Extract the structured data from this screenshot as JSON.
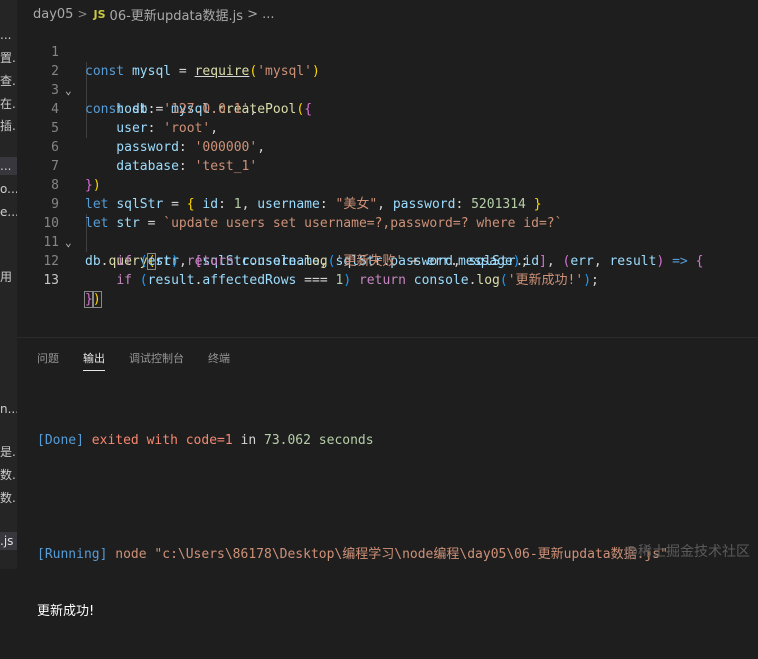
{
  "sidebar": {
    "items": [
      {
        "label": "...",
        "top": 0
      },
      {
        "label": "置...",
        "top": 0
      },
      {
        "label": "查...",
        "top": 0
      },
      {
        "label": "在...",
        "top": 0
      },
      {
        "label": "插...",
        "top": 0
      },
      {
        "label": "...",
        "top": 0
      },
      {
        "label": "o...",
        "top": 0
      },
      {
        "label": "e...",
        "top": 0
      },
      {
        "label": "用",
        "top": 0
      },
      {
        "label": "n...",
        "top": 0
      },
      {
        "label": "是...",
        "top": 0
      },
      {
        "label": "数...",
        "top": 0
      },
      {
        "label": "数...",
        "top": 0
      },
      {
        "label": ".js",
        "top": 0
      }
    ]
  },
  "breadcrumb": {
    "folder": "day05",
    "sep": ">",
    "icon": "JS",
    "file": "06-更新updata数据.js",
    "tail": "> ..."
  },
  "editor": {
    "line_numbers": [
      "1",
      "2",
      "3",
      "4",
      "5",
      "6",
      "7",
      "8",
      "9",
      "10",
      "11",
      "12",
      "13"
    ],
    "code": {
      "l1": [
        "const",
        " ",
        "mysql",
        " = ",
        "require",
        "(",
        "'mysql'",
        ")"
      ],
      "l2": [
        "const",
        " ",
        "db",
        " = ",
        "mysql",
        ".",
        "createPool",
        "(",
        "{"
      ],
      "l3": [
        "    host",
        ": ",
        "'127.0.0.1'",
        ","
      ],
      "l4": [
        "    user",
        ": ",
        "'root'",
        ","
      ],
      "l5": [
        "    password",
        ": ",
        "'000000'",
        ","
      ],
      "l6": [
        "    database",
        ": ",
        "'test_1'"
      ],
      "l7": [
        "}",
        ")"
      ],
      "l8": [
        "let",
        " ",
        "sqlStr",
        " = ",
        "{",
        " ",
        "id",
        ": ",
        "1",
        ", ",
        "username",
        ": ",
        "\"美女\"",
        ", ",
        "password",
        ": ",
        "5201314",
        " ",
        "}"
      ],
      "l9": [
        "let",
        " ",
        "str",
        " = ",
        "`update users set username=?,password=? where id=?`"
      ],
      "l10": [
        "db",
        ".",
        "query",
        "(",
        "str",
        ", ",
        "[",
        "sqlStr",
        ".",
        "username",
        ", ",
        "sqlStr",
        ".",
        "password",
        ", ",
        "sqlStr",
        ".",
        "id",
        "]",
        ", ",
        "(",
        "err",
        ", ",
        "result",
        ")",
        " => ",
        "{"
      ],
      "l11": [
        "    ",
        "if",
        " ",
        "(",
        "err",
        ")",
        " ",
        "return",
        " ",
        "console",
        ".",
        "log",
        "(",
        "'更新失败'",
        " + ",
        "err",
        ".",
        "message",
        ")",
        ";"
      ],
      "l12": [
        "    ",
        "if",
        " ",
        "(",
        "result",
        ".",
        "affectedRows",
        " === ",
        "1",
        ")",
        " ",
        "return",
        " ",
        "console",
        ".",
        "log",
        "(",
        "'更新成功!'",
        ")",
        ";"
      ],
      "l13": [
        "}",
        ")"
      ]
    }
  },
  "panel": {
    "tabs": [
      "问题",
      "输出",
      "调试控制台",
      "终端"
    ],
    "active_tab": "输出",
    "output": {
      "done_tag": "[Done]",
      "done_text": "exited with",
      "code_label": "code=1",
      "in_text": "in",
      "seconds": "73.062",
      "seconds_label": "seconds",
      "running_tag": "[Running]",
      "running_cmd": "node \"c:\\Users\\86178\\Desktop\\编程学习\\node编程\\day05\\06-更新updata数据.js\"",
      "result": "更新成功!"
    }
  },
  "watermark": "@稀土掘金技术社区",
  "colors": {
    "background": "#1e1e1e",
    "keyword": "#569cd6",
    "string": "#ce9178",
    "function": "#dcdcaa",
    "variable": "#9cdcfe",
    "number": "#b5cea8"
  }
}
